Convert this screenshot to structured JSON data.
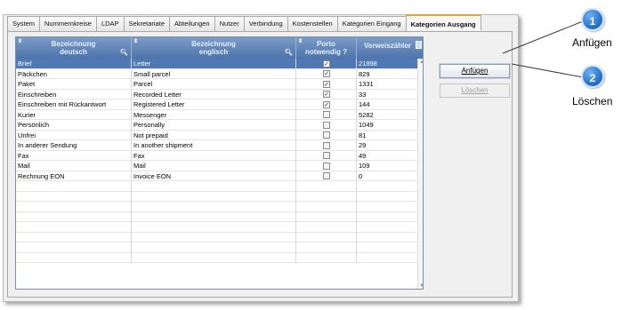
{
  "tabs": [
    {
      "label": "System",
      "active": false
    },
    {
      "label": "Nummernkreise",
      "active": false
    },
    {
      "label": "LDAP",
      "active": false
    },
    {
      "label": "Sekretariate",
      "active": false
    },
    {
      "label": "Abteilungen",
      "active": false
    },
    {
      "label": "Nutzer",
      "active": false
    },
    {
      "label": "Verbindung",
      "active": false
    },
    {
      "label": "Kostenstellen",
      "active": false
    },
    {
      "label": "Kategorien Eingang",
      "active": false
    },
    {
      "label": "Kategorien Ausgang",
      "active": true
    }
  ],
  "table": {
    "headers": {
      "col1_line1": "Bezeichnung",
      "col1_line2": "deutsch",
      "col2_line1": "Bezeichnung",
      "col2_line2": "englisch",
      "col3_line1": "Porto",
      "col3_line2": "notwendig ?",
      "col4": "Verweiszähler"
    },
    "rows": [
      {
        "de": "Brief",
        "en": "Letter",
        "porto": true,
        "count": "21898",
        "selected": true
      },
      {
        "de": "Päckchen",
        "en": "Small parcel",
        "porto": true,
        "count": "829"
      },
      {
        "de": "Paket",
        "en": "Parcel",
        "porto": true,
        "count": "1331"
      },
      {
        "de": "Einschreiben",
        "en": "Recorded Letter",
        "porto": true,
        "count": "33"
      },
      {
        "de": "Einschreiben mit Rückantwort",
        "en": "Registered Letter",
        "porto": true,
        "count": "144"
      },
      {
        "de": "Kurier",
        "en": "Messenger",
        "porto": false,
        "count": "5282"
      },
      {
        "de": "Persönlich",
        "en": "Personally",
        "porto": false,
        "count": "1049"
      },
      {
        "de": "Unfrei",
        "en": "Not prepaid",
        "porto": false,
        "count": "81"
      },
      {
        "de": "In anderer Sendung",
        "en": "In another shipment",
        "porto": false,
        "count": "29"
      },
      {
        "de": "Fax",
        "en": "Fax",
        "porto": false,
        "count": "49"
      },
      {
        "de": "Mail",
        "en": "Mail",
        "porto": false,
        "count": "109"
      },
      {
        "de": "Rechnung EON",
        "en": "Invoice EON",
        "porto": false,
        "count": "0"
      }
    ],
    "empty_rows": 8
  },
  "buttons": {
    "add": "Anfügen",
    "delete": "Löschen"
  },
  "callouts": [
    {
      "number": "1",
      "label": "Anfügen"
    },
    {
      "number": "2",
      "label": "Löschen"
    }
  ],
  "icons": {
    "sort": "sort-arrows-icon",
    "filter": "magnifier-icon",
    "columns": "column-chooser-icon",
    "check": "checkmark-icon"
  }
}
